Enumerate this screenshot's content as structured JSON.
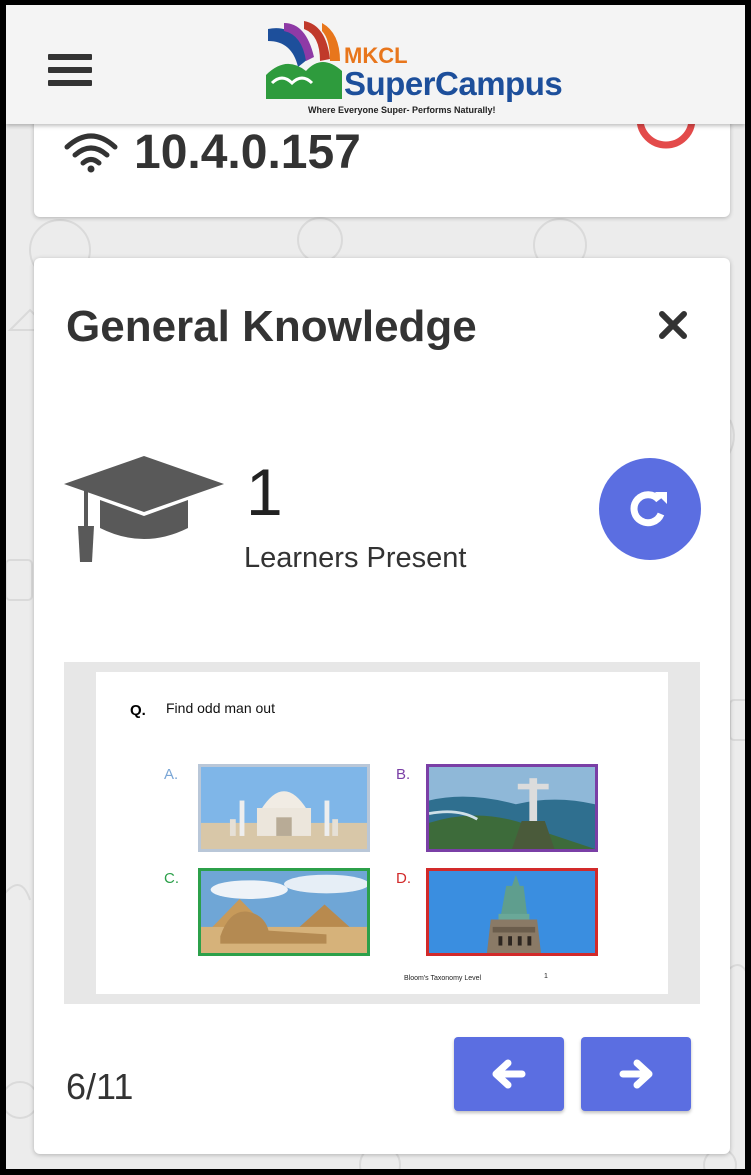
{
  "header": {
    "logo_brand_small": "MKCL",
    "logo_brand_main": "SuperCampus",
    "logo_tagline": "Where Everyone Super- Performs Naturally!"
  },
  "connection": {
    "ip_address": "10.4.0.157"
  },
  "session": {
    "title": "General Knowledge",
    "learner_count": "1",
    "learners_label": "Learners Present",
    "page_counter": "6/11"
  },
  "slide": {
    "question_label": "Q.",
    "question_text": "Find odd man out",
    "options": [
      {
        "letter": "A.",
        "color": "#7aa6d6",
        "image": "taj-mahal"
      },
      {
        "letter": "B.",
        "color": "#7a3fa6",
        "image": "christ-the-redeemer"
      },
      {
        "letter": "C.",
        "color": "#2ca04a",
        "image": "sphinx-pyramids"
      },
      {
        "letter": "D.",
        "color": "#d22a2a",
        "image": "statue-of-liberty"
      }
    ],
    "blooms_label": "Bloom's Taxonomy Level",
    "blooms_value": "1"
  },
  "icons": {
    "menu": "hamburger-icon",
    "wifi": "wifi-icon",
    "close": "close-icon",
    "learners": "graduation-cap-icon",
    "refresh": "refresh-icon",
    "prev": "arrow-left-icon",
    "next": "arrow-right-icon"
  },
  "colors": {
    "accent": "#5b6ee1",
    "status_ring": "#e34a4a",
    "text_dark": "#333333"
  }
}
